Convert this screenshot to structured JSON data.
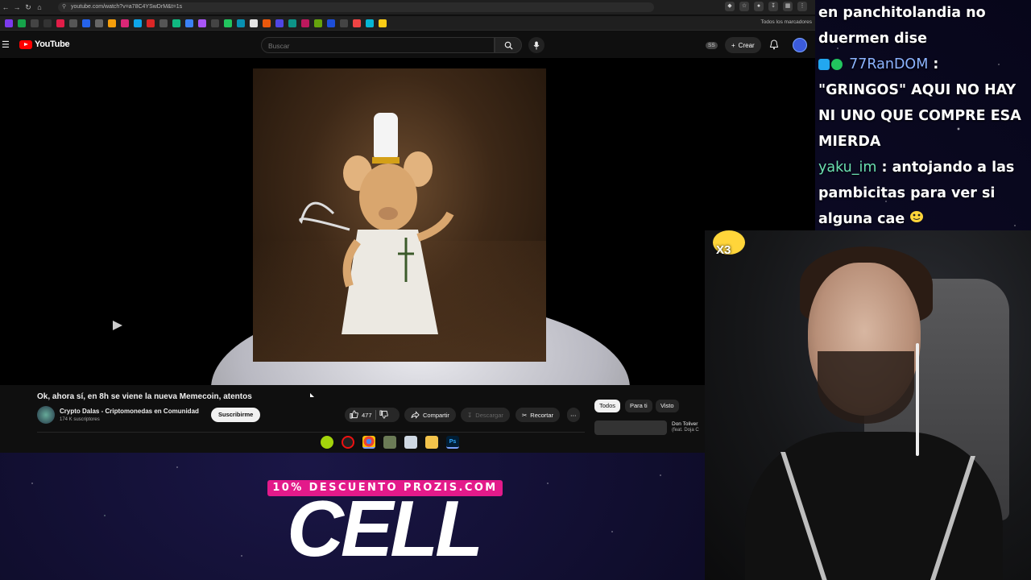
{
  "browser": {
    "url": "youtube.com/watch?v=a78C4YSwDrM&t=1s",
    "bookmarks_folder": "Todos los marcadores"
  },
  "youtube": {
    "logo_text": "YouTube",
    "search_placeholder": "Buscar",
    "badge": "SS",
    "create_label": "Crear",
    "video": {
      "title": "Ok, ahora sí, en 8h se viene la nueva Memecoin, atentos",
      "channel": "Crypto Dalas - Criptomonedas en Comunidad",
      "subscribers": "174 K suscriptores",
      "subscribe_label": "Suscribirme",
      "likes": "477",
      "share_label": "Compartir",
      "download_label": "Descargar",
      "clip_label": "Recortar"
    },
    "chips": [
      "Todos",
      "Para ti",
      "Visto"
    ],
    "recommendation": {
      "title": "Don Toliver",
      "subtitle": "(feat. Doja C"
    }
  },
  "chat": {
    "lines": [
      {
        "text": "en panchitolandia no"
      },
      {
        "text": "duermen dise"
      }
    ],
    "msg2_user": "77RanDOM",
    "msg2_sep": " :",
    "msg2_text_1": "\"GRINGOS\" AQUI NO HAY",
    "msg2_text_2": "NI UNO QUE COMPRE ESA",
    "msg2_text_3": "MIERDA",
    "msg3_user": "yaku_im",
    "msg3_text_1": " : antojando a las",
    "msg3_text_2": "pambicitas para ver si",
    "msg3_text_3": "alguna cae"
  },
  "overlay": {
    "multiplier": "X3",
    "promo_banner": "10% DESCUENTO PROZIS.COM",
    "promo_title": "CELL"
  },
  "colors": {
    "youtube_red": "#ff0000",
    "promo_pink": "#e31a8a",
    "chat_green": "#6be0b0",
    "chat_blue": "#8cb4ff"
  }
}
